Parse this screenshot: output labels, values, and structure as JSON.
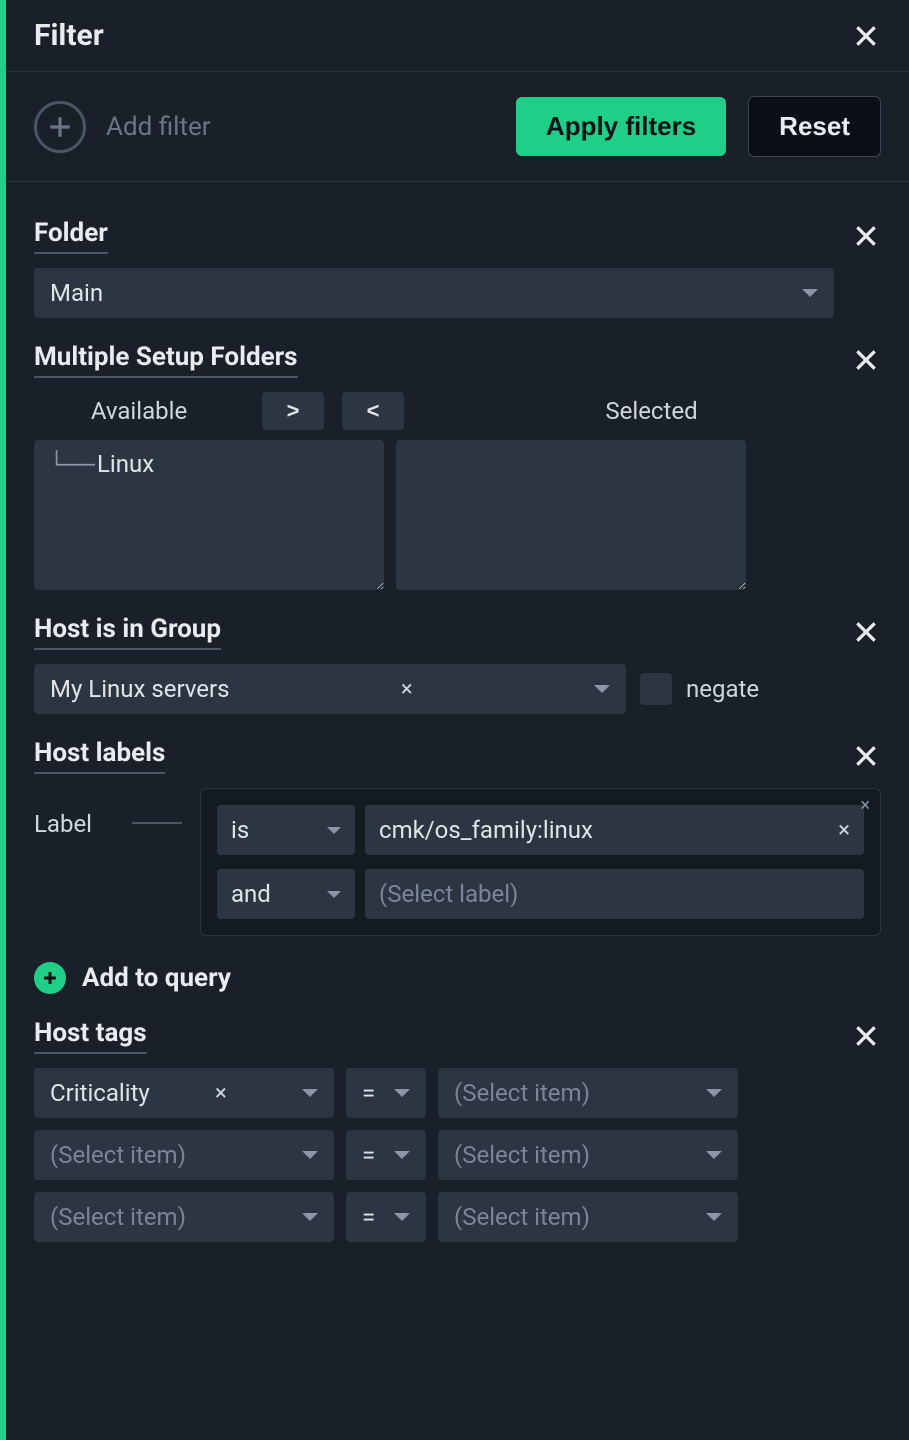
{
  "title": "Filter",
  "add_filter_label": "Add filter",
  "apply_label": "Apply filters",
  "reset_label": "Reset",
  "folder": {
    "title": "Folder",
    "value": "Main"
  },
  "multi_folders": {
    "title": "Multiple Setup Folders",
    "available_label": "Available",
    "selected_label": "Selected",
    "move_right": ">",
    "move_left": "<",
    "available_items": [
      "Linux"
    ],
    "selected_items": []
  },
  "host_in_group": {
    "title": "Host is in Group",
    "value": "My Linux servers",
    "negate_label": "negate"
  },
  "host_labels": {
    "title": "Host labels",
    "row_label": "Label",
    "query": [
      {
        "op": "is",
        "value": "cmk/os_family:linux"
      },
      {
        "op": "and",
        "value": "",
        "placeholder": "(Select label)"
      }
    ],
    "add_to_query_label": "Add to query"
  },
  "host_tags": {
    "title": "Host tags",
    "placeholder": "(Select item)",
    "op": "=",
    "rows": [
      {
        "tag": "Criticality",
        "op": "=",
        "value": ""
      },
      {
        "tag": "",
        "op": "=",
        "value": ""
      },
      {
        "tag": "",
        "op": "=",
        "value": ""
      }
    ]
  }
}
